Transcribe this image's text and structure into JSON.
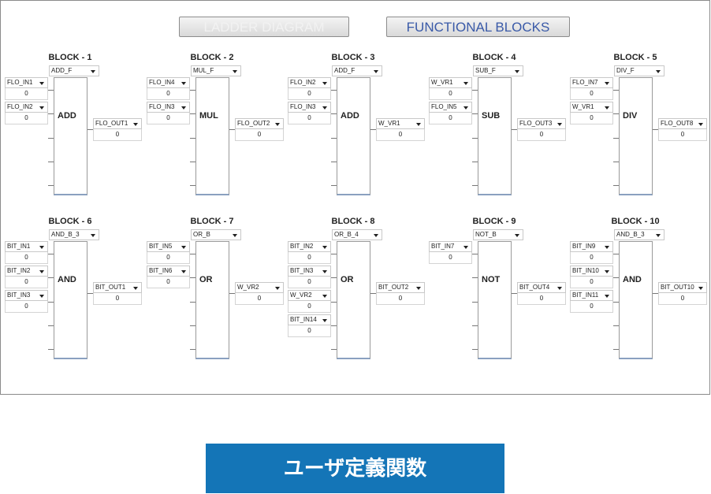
{
  "tabs": {
    "ladder": "LADDER DIAGRAM",
    "functional": "FUNCTIONAL BLOCKS"
  },
  "banner": "ユーザ定義関数",
  "colors": {
    "banner": "#1475b7",
    "active_tab_text": "#3a5aa8"
  },
  "blocks": [
    {
      "title": "BLOCK - 1",
      "func": "ADD_F",
      "op": "ADD",
      "inputs": [
        {
          "name": "FLO_IN1",
          "value": "0"
        },
        {
          "name": "FLO_IN2",
          "value": "0"
        }
      ],
      "output": {
        "name": "FLO_OUT1",
        "value": "0"
      }
    },
    {
      "title": "BLOCK - 2",
      "func": "MUL_F",
      "op": "MUL",
      "inputs": [
        {
          "name": "FLO_IN4",
          "value": "0"
        },
        {
          "name": "FLO_IN3",
          "value": "0"
        }
      ],
      "output": {
        "name": "FLO_OUT2",
        "value": "0"
      }
    },
    {
      "title": "BLOCK - 3",
      "func": "ADD_F",
      "op": "ADD",
      "inputs": [
        {
          "name": "FLO_IN2",
          "value": "0"
        },
        {
          "name": "FLO_IN3",
          "value": "0"
        }
      ],
      "output": {
        "name": "W_VR1",
        "value": "0"
      }
    },
    {
      "title": "BLOCK - 4",
      "func": "SUB_F",
      "op": "SUB",
      "inputs": [
        {
          "name": "W_VR1",
          "value": "0"
        },
        {
          "name": "FLO_IN5",
          "value": "0"
        }
      ],
      "output": {
        "name": "FLO_OUT3",
        "value": "0"
      }
    },
    {
      "title": "BLOCK - 5",
      "func": "DIV_F",
      "op": "DIV",
      "inputs": [
        {
          "name": "FLO_IN7",
          "value": "0"
        },
        {
          "name": "W_VR1",
          "value": "0"
        }
      ],
      "output": {
        "name": "FLO_OUT8",
        "value": "0"
      }
    },
    {
      "title": "BLOCK - 6",
      "func": "AND_B_3",
      "op": "AND",
      "inputs": [
        {
          "name": "BIT_IN1",
          "value": "0"
        },
        {
          "name": "BIT_IN2",
          "value": "0"
        },
        {
          "name": "BIT_IN3",
          "value": "0"
        }
      ],
      "output": {
        "name": "BIT_OUT1",
        "value": "0"
      }
    },
    {
      "title": "BLOCK - 7",
      "func": "OR_B",
      "op": "OR",
      "inputs": [
        {
          "name": "BIT_IN5",
          "value": "0"
        },
        {
          "name": "BIT_IN6",
          "value": "0"
        }
      ],
      "output": {
        "name": "W_VR2",
        "value": "0"
      }
    },
    {
      "title": "BLOCK - 8",
      "func": "OR_B_4",
      "op": "OR",
      "inputs": [
        {
          "name": "BIT_IN2",
          "value": "0"
        },
        {
          "name": "BIT_IN3",
          "value": "0"
        },
        {
          "name": "W_VR2",
          "value": "0"
        },
        {
          "name": "BIT_IN14",
          "value": "0"
        }
      ],
      "output": {
        "name": "BIT_OUT2",
        "value": "0"
      }
    },
    {
      "title": "BLOCK - 9",
      "func": "NOT_B",
      "op": "NOT",
      "inputs": [
        {
          "name": "BIT_IN7",
          "value": "0"
        }
      ],
      "output": {
        "name": "BIT_OUT4",
        "value": "0"
      }
    },
    {
      "title": "BLOCK - 10",
      "func": "AND_B_3",
      "op": "AND",
      "inputs": [
        {
          "name": "BIT_IN9",
          "value": "0"
        },
        {
          "name": "BIT_IN10",
          "value": "0"
        },
        {
          "name": "BIT_IN11",
          "value": "0"
        }
      ],
      "output": {
        "name": "BIT_OUT10",
        "value": "0"
      }
    }
  ]
}
